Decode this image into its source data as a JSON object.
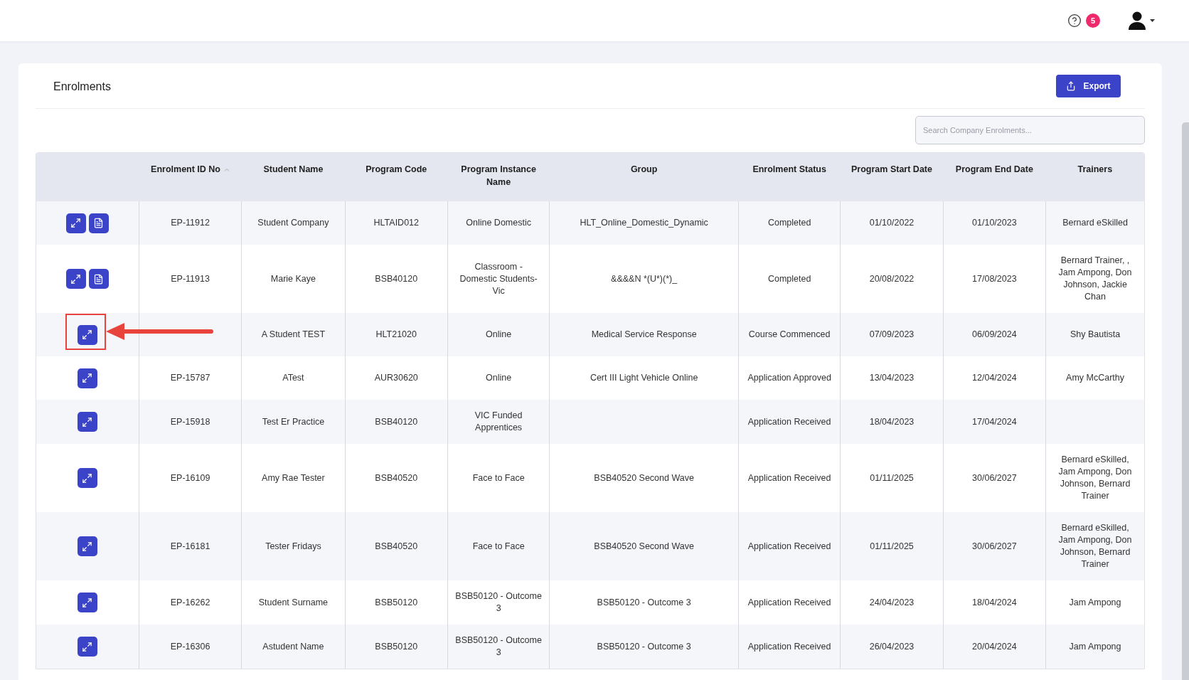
{
  "topbar": {
    "notification_count": "5"
  },
  "page": {
    "title": "Enrolments",
    "export_button": "Export",
    "search": {
      "placeholder": "Search Company Enrolments..."
    }
  },
  "table": {
    "columns": [
      {
        "label": "Enrolment ID No",
        "sorted": true
      },
      {
        "label": "Student Name",
        "sorted": false
      },
      {
        "label": "Program Code",
        "sorted": false
      },
      {
        "label": "Program Instance Name",
        "sorted": false
      },
      {
        "label": "Group",
        "sorted": false
      },
      {
        "label": "Enrolment Status",
        "sorted": false
      },
      {
        "label": "Program Start Date",
        "sorted": false
      },
      {
        "label": "Program End Date",
        "sorted": false
      },
      {
        "label": "Trainers",
        "sorted": false
      }
    ],
    "rows": [
      {
        "document": true,
        "annotated": false,
        "id": "EP-11912",
        "student": "Student Company",
        "code": "HLTAID012",
        "instance": "Online Domestic",
        "group": "HLT_Online_Domestic_Dynamic",
        "status": "Completed",
        "start": "01/10/2022",
        "end": "01/10/2023",
        "trainers": "Bernard eSkilled"
      },
      {
        "document": true,
        "annotated": false,
        "id": "EP-11913",
        "student": "Marie Kaye",
        "code": "BSB40120",
        "instance": "Classroom - Domestic Students-Vic",
        "group": "&&&&N *(U*)(*)_",
        "status": "Completed",
        "start": "20/08/2022",
        "end": "17/08/2023",
        "trainers": "Bernard Trainer, , Jam Ampong, Don Johnson, Jackie Chan"
      },
      {
        "document": false,
        "annotated": true,
        "student": "A Student TEST",
        "code": "HLT21020",
        "instance": "Online",
        "group": "Medical Service Response",
        "status": "Course Commenced",
        "start": "07/09/2023",
        "end": "06/09/2024",
        "trainers": "Shy Bautista"
      },
      {
        "document": false,
        "annotated": false,
        "id": "EP-15787",
        "student": "ATest",
        "code": "AUR30620",
        "instance": "Online",
        "group": "Cert III Light Vehicle Online",
        "status": "Application Approved",
        "start": "13/04/2023",
        "end": "12/04/2024",
        "trainers": "Amy McCarthy"
      },
      {
        "document": false,
        "annotated": false,
        "id": "EP-15918",
        "student": "Test Er Practice",
        "code": "BSB40120",
        "instance": "VIC Funded Apprentices",
        "status": "Application Received",
        "start": "18/04/2023",
        "end": "17/04/2024"
      },
      {
        "document": false,
        "annotated": false,
        "id": "EP-16109",
        "student": "Amy Rae Tester",
        "code": "BSB40520",
        "instance": "Face to Face",
        "group": "BSB40520 Second Wave",
        "status": "Application Received",
        "start": "01/11/2025",
        "end": "30/06/2027",
        "trainers": "Bernard eSkilled, Jam Ampong, Don Johnson, Bernard Trainer"
      },
      {
        "document": false,
        "annotated": false,
        "id": "EP-16181",
        "student": "Tester Fridays",
        "code": "BSB40520",
        "instance": "Face to Face",
        "group": "BSB40520 Second Wave",
        "status": "Application Received",
        "start": "01/11/2025",
        "end": "30/06/2027",
        "trainers": "Bernard eSkilled, Jam Ampong, Don Johnson, Bernard Trainer"
      },
      {
        "document": false,
        "annotated": false,
        "id": "EP-16262",
        "student": "Student Surname",
        "code": "BSB50120",
        "instance": "BSB50120 - Outcome 3",
        "group": "BSB50120 - Outcome 3",
        "status": "Application Received",
        "start": "24/04/2023",
        "end": "18/04/2024",
        "trainers": "Jam Ampong"
      },
      {
        "document": false,
        "annotated": false,
        "id": "EP-16306",
        "student": "Astudent Name",
        "code": "BSB50120",
        "instance": "BSB50120 - Outcome 3",
        "group": "BSB50120 - Outcome 3",
        "status": "Application Received",
        "start": "26/04/2023",
        "end": "20/04/2024",
        "trainers": "Jam Ampong"
      }
    ]
  }
}
